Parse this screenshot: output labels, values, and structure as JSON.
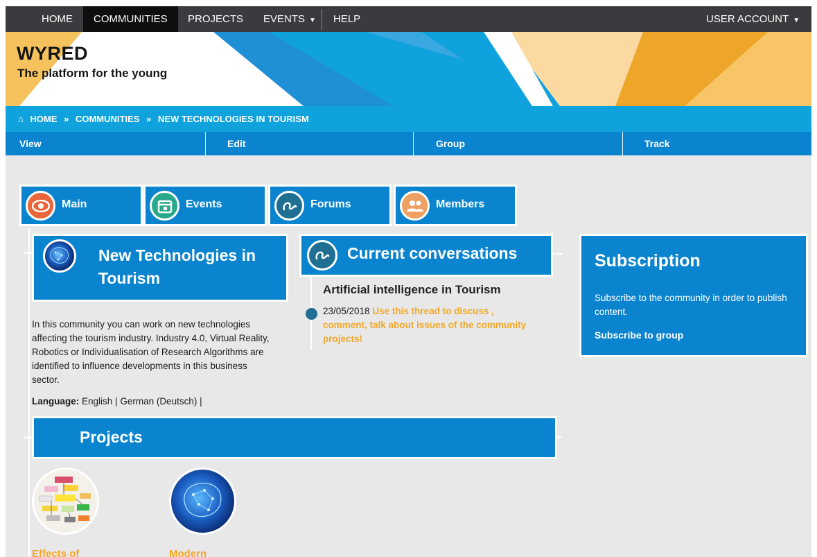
{
  "colors": {
    "nav_bg": "#3a3a3f",
    "nav_active": "#0e0e10",
    "brand_blue": "#0a84cf",
    "light_blue": "#0fa2dc",
    "banner_orange": "#eda62a",
    "accent_orange": "#f3a826",
    "page_bg": "#e8e8e8"
  },
  "nav": {
    "home": "HOME",
    "communities": "COMMUNITIES",
    "projects": "PROJECTS",
    "events": "EVENTS",
    "help": "HELP",
    "user_account": "USER ACCOUNT",
    "active": "COMMUNITIES"
  },
  "banner": {
    "title": "WYRED",
    "subtitle": "The platform for the young"
  },
  "breadcrumb": {
    "home": "HOME",
    "sep": "»",
    "communities": "COMMUNITIES",
    "current": "NEW TECHNOLOGIES IN TOURISM"
  },
  "actions": [
    "View",
    "Edit",
    "Group",
    "Track"
  ],
  "tabs": [
    {
      "label": "Main",
      "icon": "eye-icon",
      "color": "#e8663a"
    },
    {
      "label": "Events",
      "icon": "calendar-icon",
      "color": "#2aa88a"
    },
    {
      "label": "Forums",
      "icon": "forum-icon",
      "color": "#1f6f93"
    },
    {
      "label": "Members",
      "icon": "people-icon",
      "color": "#eda062"
    }
  ],
  "community": {
    "title": "New Technologies in Tourism",
    "description": "In this community you can work on new technologies affecting the tourism industry. Industry 4.0, Virtual Reality, Robotics or Individualisation of Research Algorithms are identified to influence developments in this business sector.",
    "language_label": "Language:",
    "languages": "English |  German (Deutsch) |"
  },
  "conversations": {
    "title": "Current conversations",
    "thread_title": "Artificial intelligence in Tourism",
    "date": "23/05/2018",
    "excerpt": "Use this thread to discuss , comment, talk about issues of the community projects!"
  },
  "subscription": {
    "title": "Subscription",
    "text": "Subscribe to the community in order to publish content.",
    "link": "Subscribe to group"
  },
  "projects": {
    "title": "Projects",
    "items": [
      {
        "label": "Effects of",
        "image": "flowchart-thumbnail"
      },
      {
        "label": "Modern",
        "image": "ai-brain-thumbnail"
      }
    ]
  }
}
